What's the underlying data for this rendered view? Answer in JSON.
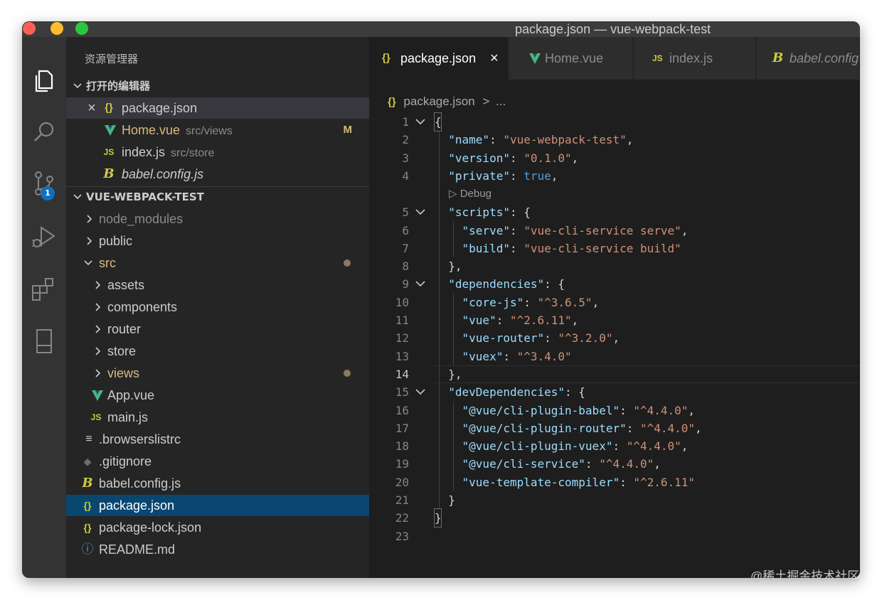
{
  "window": {
    "title": "package.json — vue-webpack-test"
  },
  "colors": {
    "red": "#ff5f57",
    "yellow": "#febc2e",
    "green": "#28c840",
    "vue": "#41b883",
    "json": "#cbcb41",
    "js": "#cbcb41",
    "modified": "#d7ba7d"
  },
  "activity_bar": {
    "icons": [
      "explorer-icon",
      "search-icon",
      "source-control-icon",
      "run-debug-icon",
      "extensions-icon",
      "remote-icon"
    ],
    "source_control_badge": "1"
  },
  "sidebar": {
    "title": "资源管理器",
    "open_editors": {
      "header": "打开的编辑器",
      "items": [
        {
          "name": "package.json",
          "desc": "",
          "icon": "{}",
          "close": "×"
        },
        {
          "name": "Home.vue",
          "desc": "src/views",
          "icon": "V",
          "mark": "M"
        },
        {
          "name": "index.js",
          "desc": "src/store",
          "icon": "JS"
        },
        {
          "name": "babel.config.js",
          "desc": "",
          "icon": "B"
        }
      ]
    },
    "project": {
      "header": "VUE-WEBPACK-TEST",
      "items": [
        {
          "name": "node_modules"
        },
        {
          "name": "public"
        },
        {
          "name": "src"
        },
        {
          "name": "assets"
        },
        {
          "name": "components"
        },
        {
          "name": "router"
        },
        {
          "name": "store"
        },
        {
          "name": "views"
        },
        {
          "name": "App.vue",
          "icon": "V"
        },
        {
          "name": "main.js",
          "icon": "JS"
        },
        {
          "name": ".browserslistrc",
          "icon": "≡"
        },
        {
          "name": ".gitignore",
          "icon": "◆"
        },
        {
          "name": "babel.config.js",
          "icon": "B"
        },
        {
          "name": "package.json",
          "icon": "{}"
        },
        {
          "name": "package-lock.json",
          "icon": "{}"
        },
        {
          "name": "README.md",
          "icon": "ⓘ"
        }
      ]
    }
  },
  "editor": {
    "tabs": [
      {
        "label": "package.json",
        "icon": "{}",
        "close": "×"
      },
      {
        "label": "Home.vue",
        "icon": "V"
      },
      {
        "label": "index.js",
        "icon": "JS"
      },
      {
        "label": "babel.config.js",
        "icon": "B"
      }
    ],
    "breadcrumb": {
      "icon": "{}",
      "file": "package.json",
      "sep": ">",
      "more": "..."
    },
    "codelens": "▷ Debug",
    "line_numbers": [
      "1",
      "2",
      "3",
      "4",
      "5",
      "6",
      "7",
      "8",
      "9",
      "10",
      "11",
      "12",
      "13",
      "14",
      "15",
      "16",
      "17",
      "18",
      "19",
      "20",
      "21",
      "22",
      "23"
    ]
  },
  "watermark": "@稀土掘金技术社区"
}
